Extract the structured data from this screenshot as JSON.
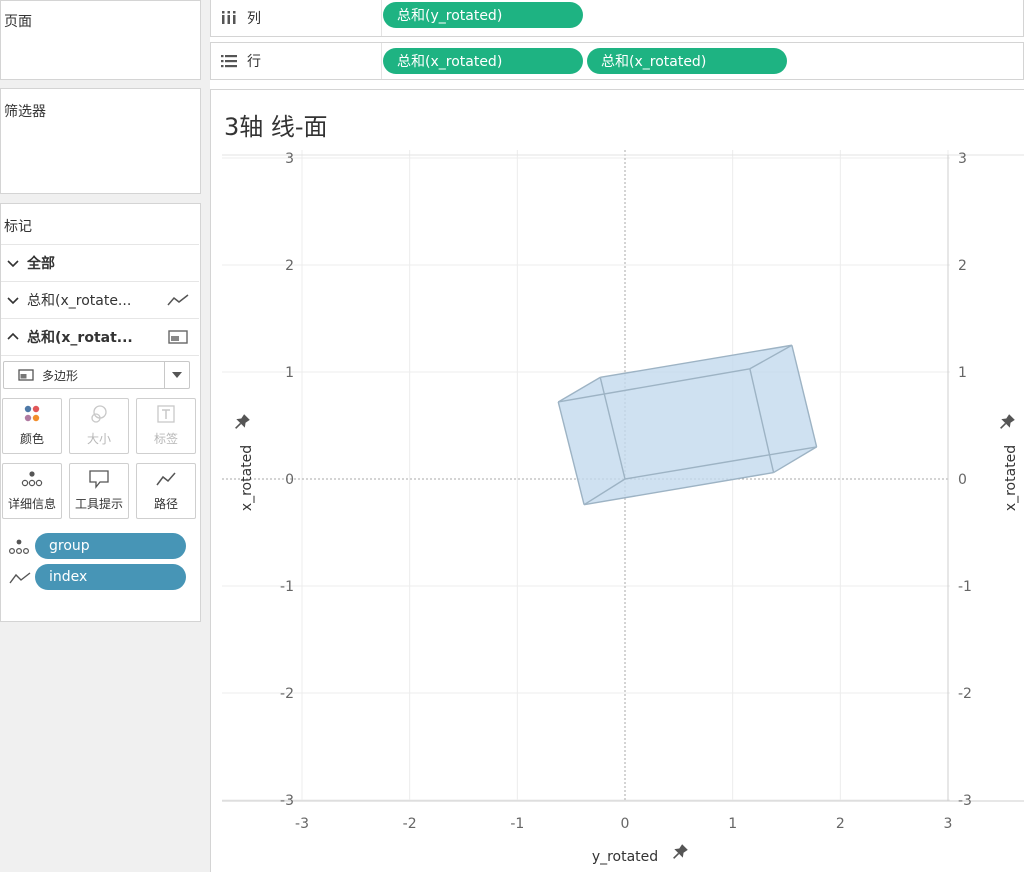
{
  "left": {
    "pages_title": "页面",
    "filters_title": "筛选器",
    "marks_title": "标记",
    "mark_rows": [
      {
        "label": "全部",
        "bold": true,
        "expanded": false,
        "icon": "none"
      },
      {
        "label": "总和(x_rotate...",
        "bold": false,
        "expanded": false,
        "icon": "line-mark-icon"
      },
      {
        "label": "总和(x_rotat...",
        "bold": true,
        "expanded": true,
        "icon": "polygon-mark-icon"
      }
    ],
    "mark_type": "多边形",
    "buttons": [
      {
        "label": "颜色",
        "icon": "color-dots-icon",
        "enabled": true
      },
      {
        "label": "大小",
        "icon": "size-circles-icon",
        "enabled": false
      },
      {
        "label": "标签",
        "icon": "label-text-icon",
        "enabled": false
      },
      {
        "label": "详细信息",
        "icon": "detail-dots-icon",
        "enabled": true
      },
      {
        "label": "工具提示",
        "icon": "tooltip-bubble-icon",
        "enabled": true
      },
      {
        "label": "路径",
        "icon": "path-line-icon",
        "enabled": true
      }
    ],
    "fields": [
      {
        "label": "group",
        "icon": "detail-dots-icon"
      },
      {
        "label": "index",
        "icon": "path-line-icon"
      }
    ]
  },
  "shelves": {
    "columns_label": "列",
    "columns_pills": [
      "总和(y_rotated)"
    ],
    "rows_label": "行",
    "rows_pills": [
      "总和(x_rotated)",
      "总和(x_rotated)"
    ]
  },
  "chart_data": {
    "type": "area",
    "title": "3轴 线-面",
    "xlabel": "y_rotated",
    "ylabel_left": "x_rotated",
    "ylabel_right": "x_rotated",
    "xlim": [
      -3,
      3
    ],
    "ylim": [
      -3,
      3
    ],
    "xticks": [
      "-3",
      "-2",
      "-1",
      "0",
      "1",
      "2",
      "3"
    ],
    "yticks": [
      "3",
      "2",
      "1",
      "0",
      "-1",
      "-2",
      "-3"
    ],
    "grid": true,
    "colors": {
      "fill": "#c3daee",
      "stroke": "#9db3c4"
    },
    "shape_vertices": {
      "A": [
        -0.62,
        0.72
      ],
      "B": [
        -0.23,
        0.95
      ],
      "C": [
        1.55,
        1.25
      ],
      "D": [
        1.78,
        0.3
      ],
      "E": [
        1.38,
        0.06
      ],
      "F": [
        -0.38,
        -0.24
      ],
      "G": [
        1.16,
        1.03
      ],
      "H": [
        0.0,
        0.0
      ]
    },
    "edges": [
      [
        "A",
        "B"
      ],
      [
        "B",
        "C"
      ],
      [
        "C",
        "D"
      ],
      [
        "D",
        "E"
      ],
      [
        "E",
        "F"
      ],
      [
        "F",
        "A"
      ],
      [
        "A",
        "G"
      ],
      [
        "G",
        "C"
      ],
      [
        "G",
        "E"
      ],
      [
        "B",
        "H"
      ],
      [
        "H",
        "F"
      ],
      [
        "H",
        "D"
      ]
    ]
  }
}
